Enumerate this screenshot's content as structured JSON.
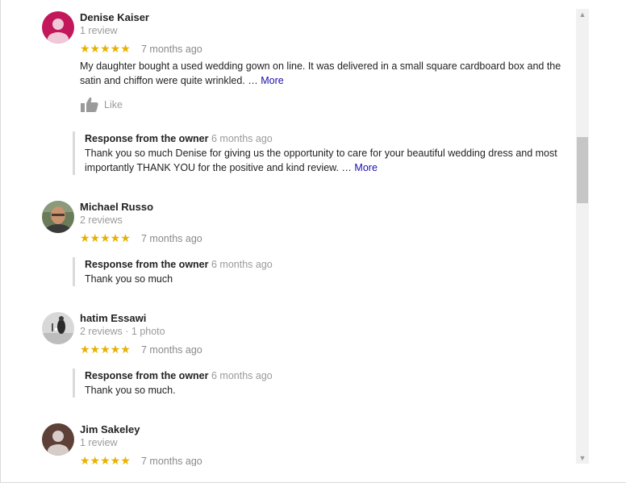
{
  "reviews": [
    {
      "name": "Denise Kaiser",
      "meta": "1 review",
      "stars": "★★★★★",
      "rating": 5,
      "time": "7 months ago",
      "text": "My daughter bought a used wedding gown on line. It was delivered in a small  square cardboard box and the satin and chiffon were quite wrinkled. …",
      "more": "More",
      "like_label": "Like",
      "avatar_color": "#c2185b",
      "response": {
        "title": "Response from the owner",
        "time": "6 months ago",
        "text": "Thank you so much Denise for giving us the opportunity to care for your beautiful wedding dress and most importantly THANK YOU for the positive and kind review. …",
        "more": "More"
      }
    },
    {
      "name": "Michael Russo",
      "meta": "2 reviews",
      "stars": "★★★★★",
      "rating": 5,
      "time": "7 months ago",
      "response": {
        "title": "Response from the owner",
        "time": "6 months ago",
        "text": "Thank you so much"
      }
    },
    {
      "name": "hatim Essawi",
      "meta": "2 reviews · 1 photo",
      "stars": "★★★★★",
      "rating": 5,
      "time": "7 months ago",
      "response": {
        "title": "Response from the owner",
        "time": "6 months ago",
        "text": "Thank you so much."
      }
    },
    {
      "name": "Jim Sakeley",
      "meta": "1 review",
      "stars": "★★★★★",
      "rating": 5,
      "time": "7 months ago",
      "avatar_color": "#5d4037"
    }
  ],
  "scrollbar": {
    "up_arrow": "▲",
    "down_arrow": "▼",
    "position": 0.28
  },
  "colors": {
    "star": "#e7b100",
    "link": "#1a0dab",
    "muted": "#9a9a9a"
  }
}
